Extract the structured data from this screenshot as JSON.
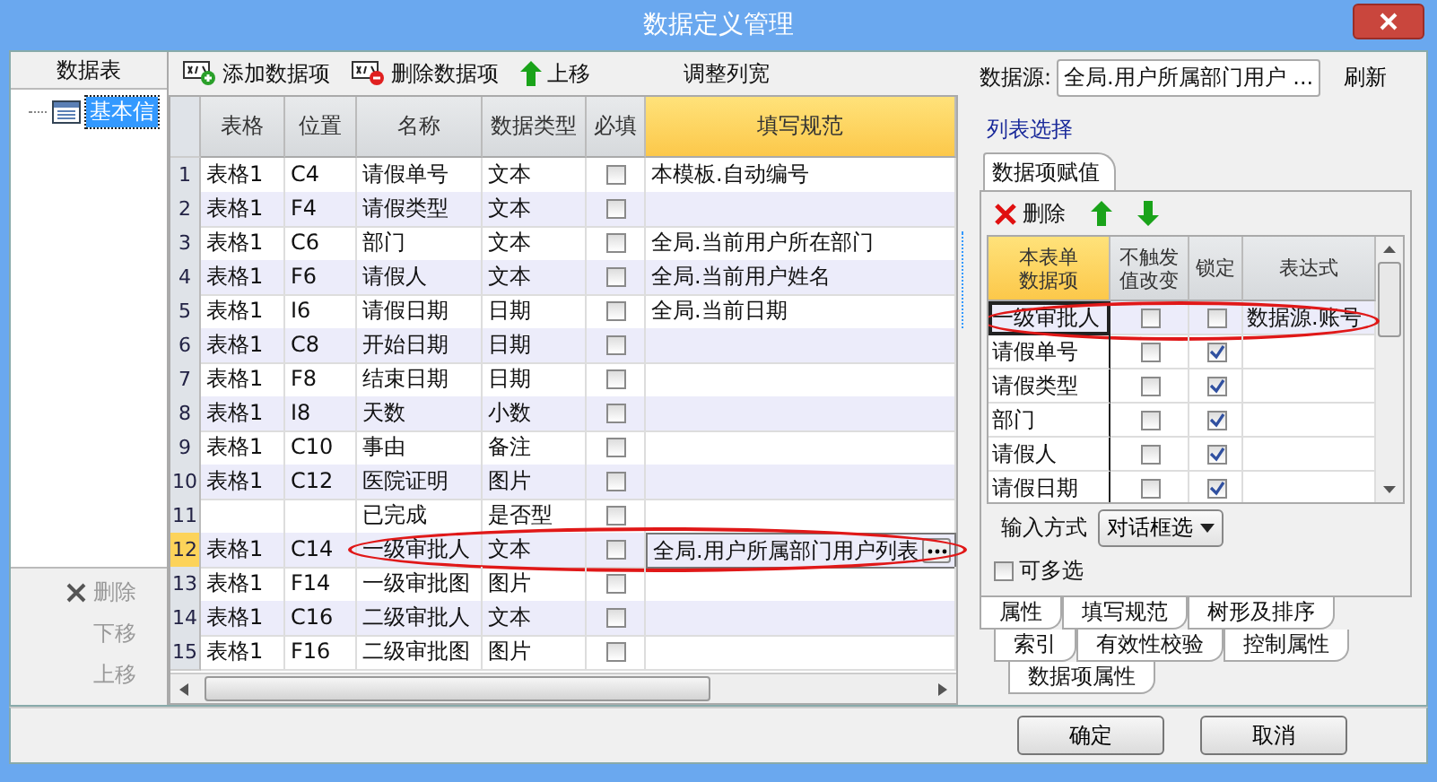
{
  "window": {
    "title": "数据定义管理"
  },
  "left_panel": {
    "header": "数据表",
    "tree_items": [
      {
        "label": "基本信",
        "selected": true
      }
    ],
    "buttons": [
      {
        "label": "删除",
        "kind": "delete",
        "disabled": true
      },
      {
        "label": "下移",
        "kind": "plain",
        "disabled": true
      },
      {
        "label": "上移",
        "kind": "plain",
        "disabled": true
      }
    ]
  },
  "toolbar": [
    {
      "label": "添加数据项",
      "kind": "add"
    },
    {
      "label": "删除数据项",
      "kind": "remove"
    },
    {
      "label": "上移",
      "kind": "up"
    },
    {
      "label": "调整列宽",
      "kind": "plain"
    }
  ],
  "table": {
    "columns": [
      {
        "label": "表格",
        "selected": false
      },
      {
        "label": "位置",
        "selected": false
      },
      {
        "label": "名称",
        "selected": false
      },
      {
        "label": "数据类型",
        "selected": false
      },
      {
        "label": "必填",
        "selected": false
      },
      {
        "label": "填写规范",
        "selected": true
      }
    ],
    "rows": [
      {
        "number": "1",
        "table": "表格1",
        "position": "C4",
        "name": "请假单号",
        "type": "文本",
        "required": false,
        "rule": "本模板.自动编号",
        "selected": false,
        "circled": false
      },
      {
        "number": "2",
        "table": "表格1",
        "position": "F4",
        "name": "请假类型",
        "type": "文本",
        "required": false,
        "rule": "",
        "selected": false,
        "circled": false
      },
      {
        "number": "3",
        "table": "表格1",
        "position": "C6",
        "name": "部门",
        "type": "文本",
        "required": false,
        "rule": "全局.当前用户所在部门",
        "selected": false,
        "circled": false
      },
      {
        "number": "4",
        "table": "表格1",
        "position": "F6",
        "name": "请假人",
        "type": "文本",
        "required": false,
        "rule": "全局.当前用户姓名",
        "selected": false,
        "circled": false
      },
      {
        "number": "5",
        "table": "表格1",
        "position": "I6",
        "name": "请假日期",
        "type": "日期",
        "required": false,
        "rule": "全局.当前日期",
        "selected": false,
        "circled": false
      },
      {
        "number": "6",
        "table": "表格1",
        "position": "C8",
        "name": "开始日期",
        "type": "日期",
        "required": false,
        "rule": "",
        "selected": false,
        "circled": false
      },
      {
        "number": "7",
        "table": "表格1",
        "position": "F8",
        "name": "结束日期",
        "type": "日期",
        "required": false,
        "rule": "",
        "selected": false,
        "circled": false
      },
      {
        "number": "8",
        "table": "表格1",
        "position": "I8",
        "name": "天数",
        "type": "小数",
        "required": false,
        "rule": "",
        "selected": false,
        "circled": false
      },
      {
        "number": "9",
        "table": "表格1",
        "position": "C10",
        "name": "事由",
        "type": "备注",
        "required": false,
        "rule": "",
        "selected": false,
        "circled": false
      },
      {
        "number": "10",
        "table": "表格1",
        "position": "C12",
        "name": "医院证明",
        "type": "图片",
        "required": false,
        "rule": "",
        "selected": false,
        "circled": false
      },
      {
        "number": "11",
        "table": "",
        "position": "",
        "name": "已完成",
        "type": "是否型",
        "required": false,
        "rule": "",
        "selected": false,
        "circled": false
      },
      {
        "number": "12",
        "table": "表格1",
        "position": "C14",
        "name": "一级审批人",
        "type": "文本",
        "required": false,
        "rule": "全局.用户所属部门用户列表",
        "selected": true,
        "circled": true
      },
      {
        "number": "13",
        "table": "表格1",
        "position": "F14",
        "name": "一级审批图",
        "type": "图片",
        "required": false,
        "rule": "",
        "selected": false,
        "circled": false
      },
      {
        "number": "14",
        "table": "表格1",
        "position": "C16",
        "name": "二级审批人",
        "type": "文本",
        "required": false,
        "rule": "",
        "selected": false,
        "circled": false
      },
      {
        "number": "15",
        "table": "表格1",
        "position": "F16",
        "name": "二级审批图",
        "type": "图片",
        "required": false,
        "rule": "",
        "selected": false,
        "circled": false
      }
    ]
  },
  "right_panel": {
    "datasource": {
      "label": "数据源:",
      "value": "全局.用户所属部门用户 ...",
      "button": "刷新"
    },
    "link": "列表选择",
    "tab": {
      "label": "数据项赋值",
      "selected": true
    },
    "toolbar": [
      {
        "label": "删除",
        "kind": "delete"
      },
      {
        "kind": "up"
      },
      {
        "kind": "down"
      }
    ],
    "columns": [
      {
        "label": "本表单数据项",
        "selected": true
      },
      {
        "label": "不触发值改变",
        "selected": false
      },
      {
        "label": "锁定",
        "selected": false
      },
      {
        "label": "表达式",
        "selected": false
      }
    ],
    "rows": [
      {
        "item": "一级审批人",
        "no_trigger": false,
        "locked": false,
        "expression": "数据源.账号",
        "selected": true,
        "circled": true
      },
      {
        "item": "请假单号",
        "no_trigger": false,
        "locked": true,
        "expression": "",
        "selected": false,
        "circled": false
      },
      {
        "item": "请假类型",
        "no_trigger": false,
        "locked": true,
        "expression": "",
        "selected": false,
        "circled": false
      },
      {
        "item": "部门",
        "no_trigger": false,
        "locked": true,
        "expression": "",
        "selected": false,
        "circled": false
      },
      {
        "item": "请假人",
        "no_trigger": false,
        "locked": true,
        "expression": "",
        "selected": false,
        "circled": false
      },
      {
        "item": "请假日期",
        "no_trigger": false,
        "locked": true,
        "expression": "",
        "selected": false,
        "circled": false
      }
    ],
    "input_mode": {
      "label": "输入方式",
      "value": "对话框选"
    },
    "multi_select": {
      "label": "可多选",
      "checked": false
    },
    "tab_rows": [
      [
        "属性",
        "填写规范",
        "树形及排序"
      ],
      [
        "索引",
        "有效性校验",
        "控制属性"
      ],
      [
        "数据项属性"
      ]
    ]
  },
  "footer": {
    "buttons": [
      "确定",
      "取消"
    ]
  }
}
